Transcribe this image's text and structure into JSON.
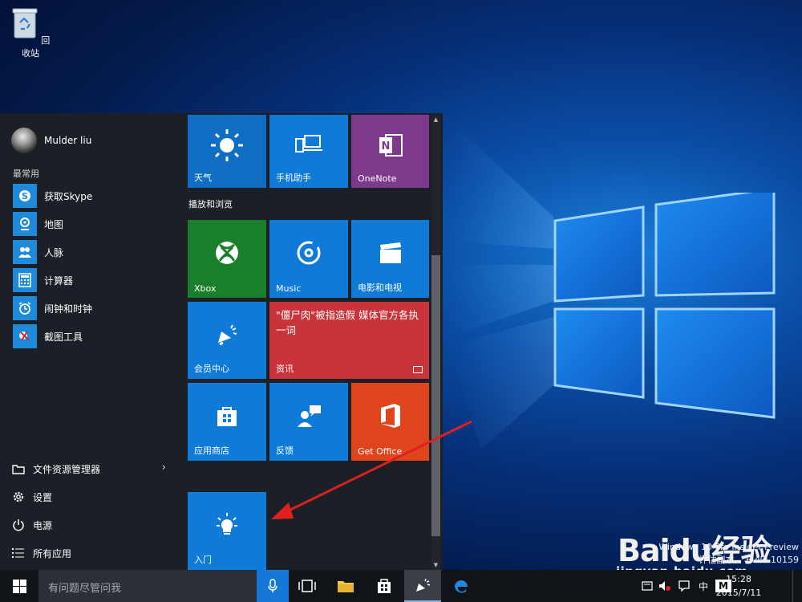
{
  "desktop": {
    "recycle_bin_label": "回收站",
    "build_info_line1": "Windows 10 Pro Insider Preview",
    "build_info_line2": "评估副本。 Build 10159"
  },
  "start_menu": {
    "user_name": "Mulder liu",
    "most_used_label": "最常用",
    "apps": [
      {
        "label": "获取Skype",
        "icon": "skype-icon",
        "color": "#1f8ad9"
      },
      {
        "label": "地图",
        "icon": "map-icon",
        "color": "#1f8ad9"
      },
      {
        "label": "人脉",
        "icon": "people-icon",
        "color": "#1f8ad9"
      },
      {
        "label": "计算器",
        "icon": "calculator-icon",
        "color": "#1f8ad9"
      },
      {
        "label": "闹钟和时钟",
        "icon": "alarm-clock-icon",
        "color": "#1f8ad9"
      },
      {
        "label": "截图工具",
        "icon": "snipping-tool-icon",
        "color": "#1f8ad9"
      }
    ],
    "system_items": [
      {
        "label": "文件资源管理器",
        "icon": "folder-icon",
        "chevron": "›"
      },
      {
        "label": "设置",
        "icon": "gear-icon"
      },
      {
        "label": "电源",
        "icon": "power-icon"
      },
      {
        "label": "所有应用",
        "icon": "list-icon"
      }
    ],
    "group_label": "播放和浏览",
    "tiles": {
      "weather": {
        "label": "天气",
        "color": "#0f6ec4"
      },
      "phone": {
        "label": "手机助手",
        "color": "#0f7ad8"
      },
      "onenote": {
        "label": "OneNote",
        "color": "#7d3a8c"
      },
      "xbox": {
        "label": "Xbox",
        "color": "#1a7f2a"
      },
      "music": {
        "label": "Music",
        "color": "#0f7ad8"
      },
      "movies": {
        "label": "电影和电视",
        "color": "#0f7ad8"
      },
      "member": {
        "label": "会员中心",
        "color": "#0f7ad8"
      },
      "news": {
        "label": "资讯",
        "headline": "\"僵尸肉\"被指造假 媒体官方各执一词",
        "color": "#c9333a"
      },
      "store": {
        "label": "应用商店",
        "color": "#0f7ad8"
      },
      "feedback": {
        "label": "反馈",
        "color": "#0f7ad8"
      },
      "getoffice": {
        "label": "Get Office",
        "color": "#e0441c"
      },
      "getstarted": {
        "label": "入门",
        "color": "#0f7ad8"
      }
    }
  },
  "taskbar": {
    "search_placeholder": "有问题尽管问我",
    "ime_label": "中",
    "ime_mode": "M",
    "time": "15:28",
    "date": "2015/7/11"
  },
  "watermark": {
    "logo_text": "Baidu经验",
    "site": "jingyan.baidu.com"
  },
  "annotation": {
    "arrow_color": "#e02020"
  }
}
